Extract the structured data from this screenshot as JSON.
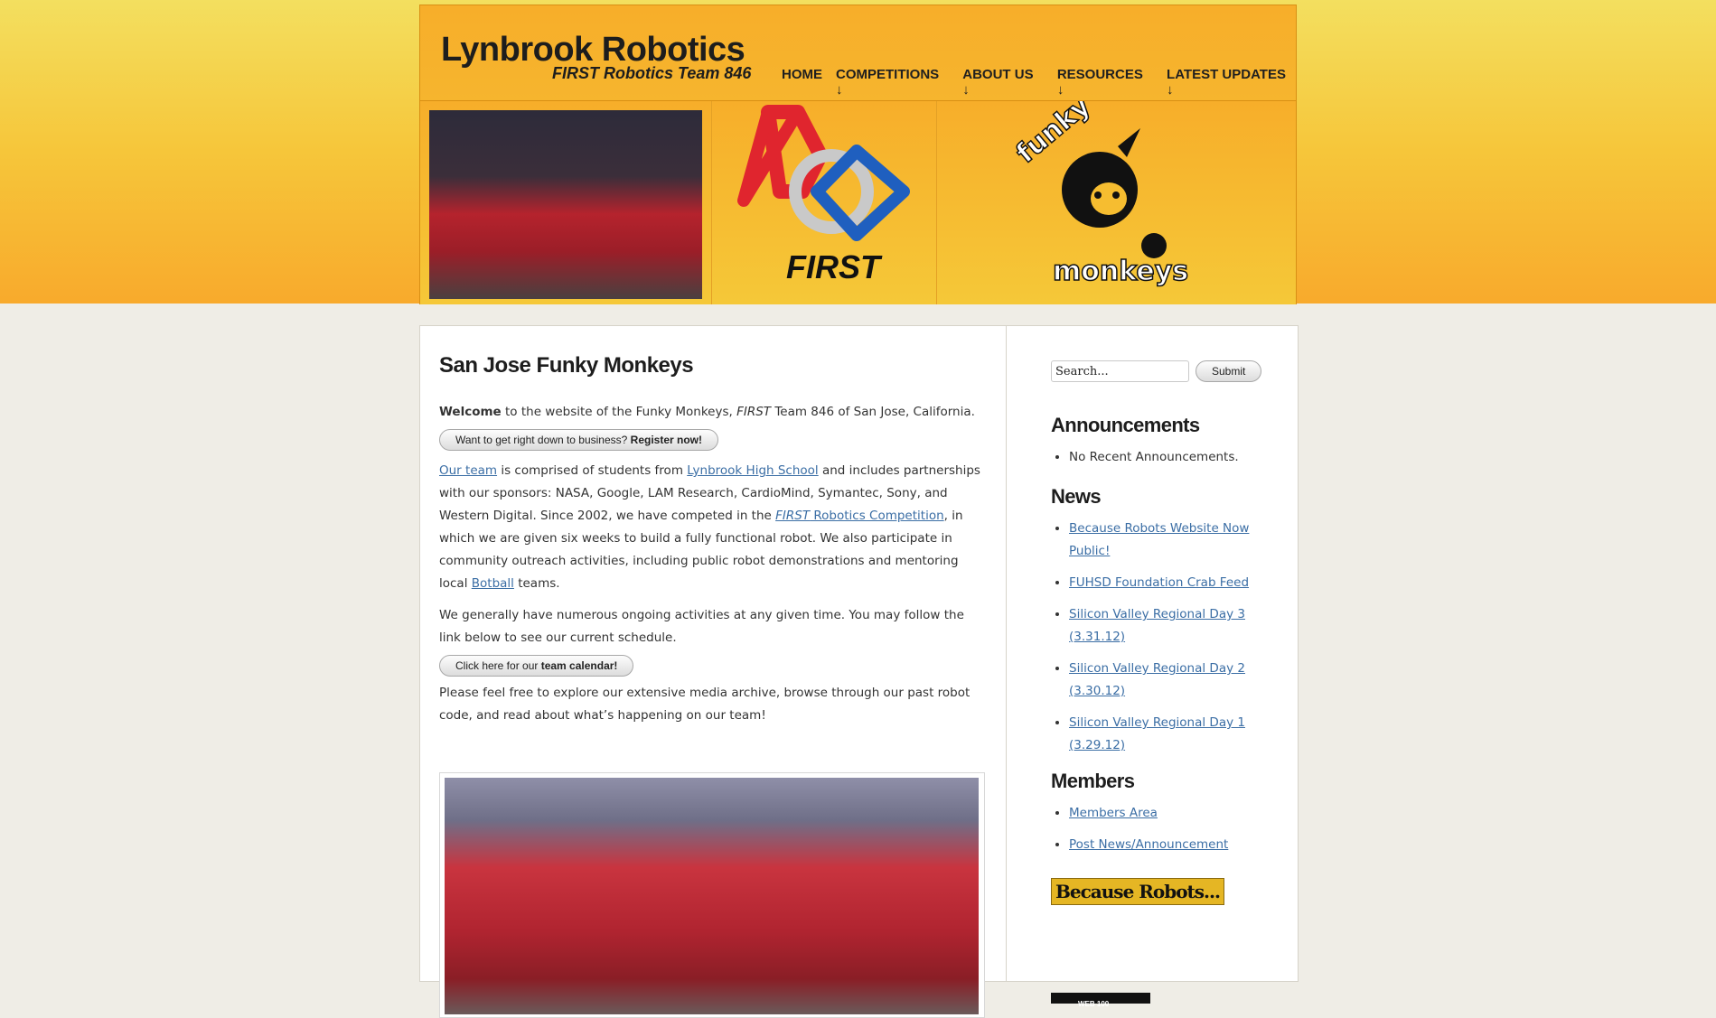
{
  "header": {
    "site_title": "Lynbrook Robotics",
    "site_subtitle": "FIRST Robotics Team 846"
  },
  "nav": {
    "items": [
      {
        "label": "HOME"
      },
      {
        "label": "COMPETITIONS ↓"
      },
      {
        "label": "ABOUT US ↓"
      },
      {
        "label": "RESOURCES ↓"
      },
      {
        "label": "LATEST UPDATES ↓"
      }
    ]
  },
  "banner": {
    "first_logo_text": "FIRST",
    "funky_text": "funky",
    "monkeys_text": "monkeys"
  },
  "main": {
    "title": "San Jose Funky Monkeys",
    "welcome_bold": "Welcome",
    "welcome_text_1": " to the website of the Funky Monkeys, ",
    "welcome_first": "FIRST",
    "welcome_text_2": " Team 846 of San Jose, California.",
    "register_button_text": "Want to get right down to business? ",
    "register_button_bold": "Register now!",
    "para2_link_team": "Our team",
    "para2_text_1": " is comprised of students from ",
    "para2_link_school": "Lynbrook High School",
    "para2_text_2": " and includes partnerships with our sponsors: NASA, Google, LAM Research, CardioMind, Symantec, Sony, and Western Digital. Since 2002, we have competed in the ",
    "para2_link_first": "FIRST",
    "para2_link_frc": " Robotics Competition",
    "para2_text_3": ", in which we are given six weeks to build a fully functional robot. We also participate in community outreach activities, including public robot demonstrations and mentoring local ",
    "para2_link_botball": "Botball",
    "para2_text_4": " teams.",
    "para3": "We generally have numerous ongoing activities at any given time. You may follow the link below to see our current schedule.",
    "calendar_button_text": "Click here for our ",
    "calendar_button_bold": "team calendar!",
    "para4": "Please feel free to explore our extensive media archive, browse through our past robot code, and read about what’s happening on our team!"
  },
  "sidebar": {
    "search_placeholder": "Search...",
    "submit_label": "Submit",
    "announcements_heading": "Announcements",
    "announcements": [
      "No Recent Announcements."
    ],
    "news_heading": "News",
    "news": [
      "Because Robots Website Now Public!",
      "FUHSD Foundation Crab Feed",
      "Silicon Valley Regional Day 3 (3.31.12)",
      "Silicon Valley Regional Day 2 (3.30.12)",
      "Silicon Valley Regional Day 1 (3.29.12)"
    ],
    "members_heading": "Members",
    "members": [
      "Members Area",
      "Post News/Announcement"
    ],
    "because_robots_banner": "Because Robots...",
    "web_badge_text": "WEB 100"
  },
  "colors": {
    "header_orange": "#f7ae2a",
    "link_blue": "#3b6ea5",
    "first_red": "#e0252e",
    "first_blue": "#1f5fbf"
  }
}
